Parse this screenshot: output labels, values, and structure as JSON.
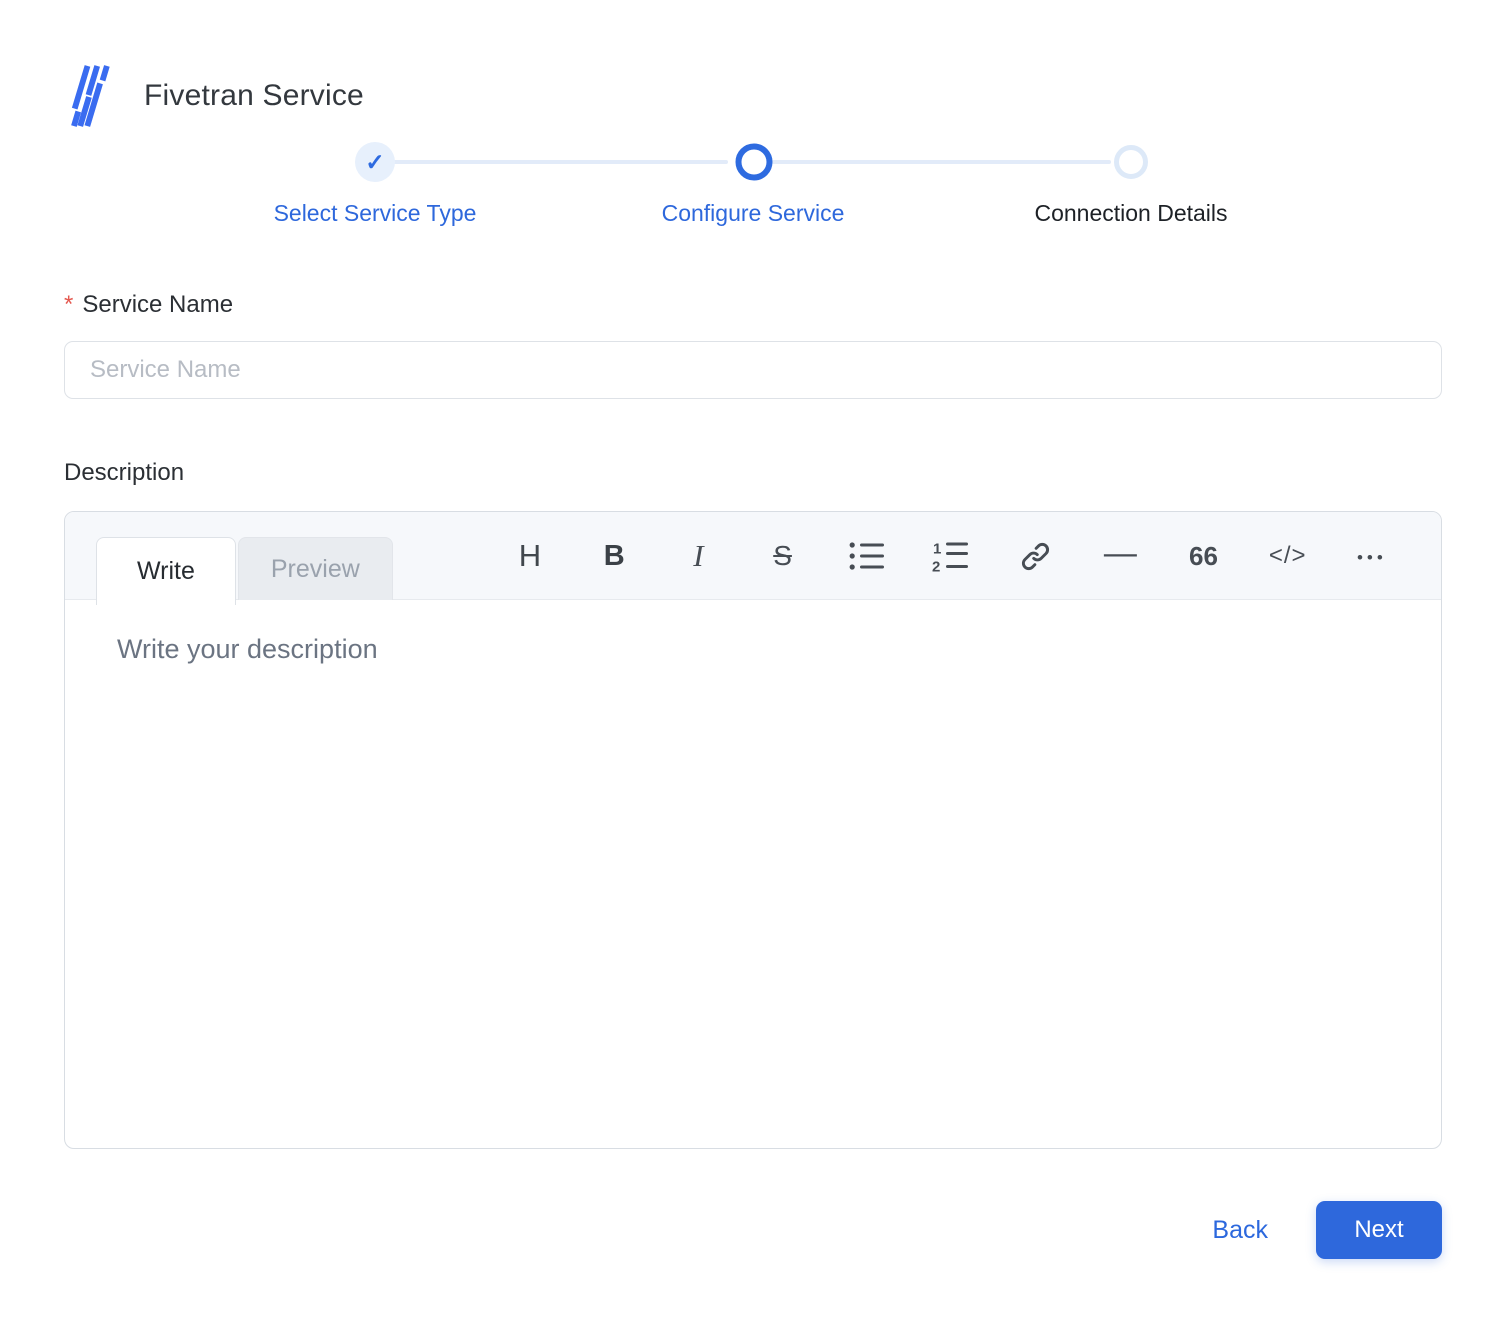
{
  "header": {
    "title": "Fivetran Service"
  },
  "stepper": {
    "steps": [
      {
        "label": "Select Service Type",
        "state": "completed",
        "glyph": "✓"
      },
      {
        "label": "Configure Service",
        "state": "active"
      },
      {
        "label": "Connection Details",
        "state": "upcoming"
      }
    ]
  },
  "form": {
    "service_name": {
      "required_marker": "*",
      "label": "Service Name",
      "placeholder": "Service Name",
      "value": ""
    },
    "description": {
      "label": "Description",
      "editor": {
        "tabs": [
          {
            "label": "Write",
            "active": true
          },
          {
            "label": "Preview",
            "active": false
          }
        ],
        "toolbar": [
          {
            "name": "heading-icon",
            "glyph": "H"
          },
          {
            "name": "bold-icon",
            "glyph": "B"
          },
          {
            "name": "italic-icon",
            "glyph": "I"
          },
          {
            "name": "strikethrough-icon",
            "glyph": "S"
          },
          {
            "name": "unordered-list-icon"
          },
          {
            "name": "ordered-list-icon"
          },
          {
            "name": "link-icon"
          },
          {
            "name": "horizontal-rule-icon",
            "glyph": "—"
          },
          {
            "name": "quote-icon",
            "glyph": "66"
          },
          {
            "name": "code-icon",
            "glyph": "</>"
          },
          {
            "name": "more-options-icon",
            "glyph": "•••"
          }
        ],
        "placeholder": "Write your description",
        "value": ""
      }
    }
  },
  "footer": {
    "back_label": "Back",
    "next_label": "Next"
  },
  "colors": {
    "accent": "#2e6be0",
    "logo_blue": "#3a6cf0",
    "step_done_halo": "#e7f0fc",
    "step_todo_ring": "#dde9f8",
    "connector": "#e2ebf9",
    "required": "#e4584f",
    "editor_header_bg": "#f6f8fb"
  }
}
